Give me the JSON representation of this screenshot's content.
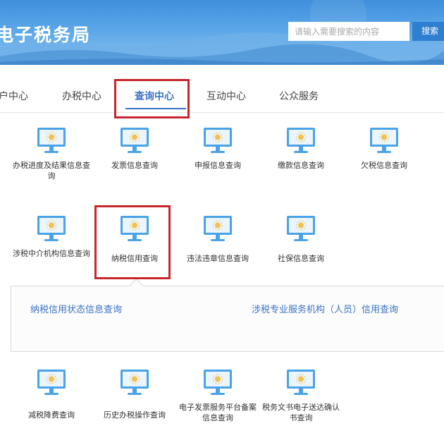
{
  "header": {
    "site_title": "电子税务局",
    "search_placeholder": "请输入需要搜索的内容",
    "search_button": "搜索"
  },
  "tabs": [
    {
      "label": "户中心",
      "active": false
    },
    {
      "label": "办税中心",
      "active": false
    },
    {
      "label": "查询中心",
      "active": true
    },
    {
      "label": "互动中心",
      "active": false
    },
    {
      "label": "公众服务",
      "active": false
    }
  ],
  "rows": [
    [
      {
        "label": "办税进度及结果信息查询",
        "icon": "monitor-icon"
      },
      {
        "label": "发票信息查询",
        "icon": "monitor-icon"
      },
      {
        "label": "申报信息查询",
        "icon": "monitor-icon"
      },
      {
        "label": "缴款信息查询",
        "icon": "monitor-icon"
      },
      {
        "label": "欠税信息查询",
        "icon": "monitor-icon"
      }
    ],
    [
      {
        "label": "涉税中介机构信息查询",
        "icon": "monitor-icon"
      },
      {
        "label": "纳税信用查询",
        "icon": "monitor-icon"
      },
      {
        "label": "违法违章信息查询",
        "icon": "monitor-icon"
      },
      {
        "label": "社保信息查询",
        "icon": "monitor-icon"
      }
    ],
    [
      {
        "label": "减税降费查询",
        "icon": "monitor-icon"
      },
      {
        "label": "历史办税操作查询",
        "icon": "monitor-icon"
      },
      {
        "label": "电子发票服务平台备案信息查询",
        "icon": "monitor-icon"
      },
      {
        "label": "税务文书电子送达确认书查询",
        "icon": "monitor-icon"
      }
    ]
  ],
  "subpanel": {
    "links": [
      "纳税信用状态信息查询",
      "涉税专业服务机构（人员）信用查询"
    ]
  },
  "colors": {
    "accent": "#3a73c4",
    "highlight": "#c8262c",
    "icon_screen": "#4aa3e6"
  }
}
